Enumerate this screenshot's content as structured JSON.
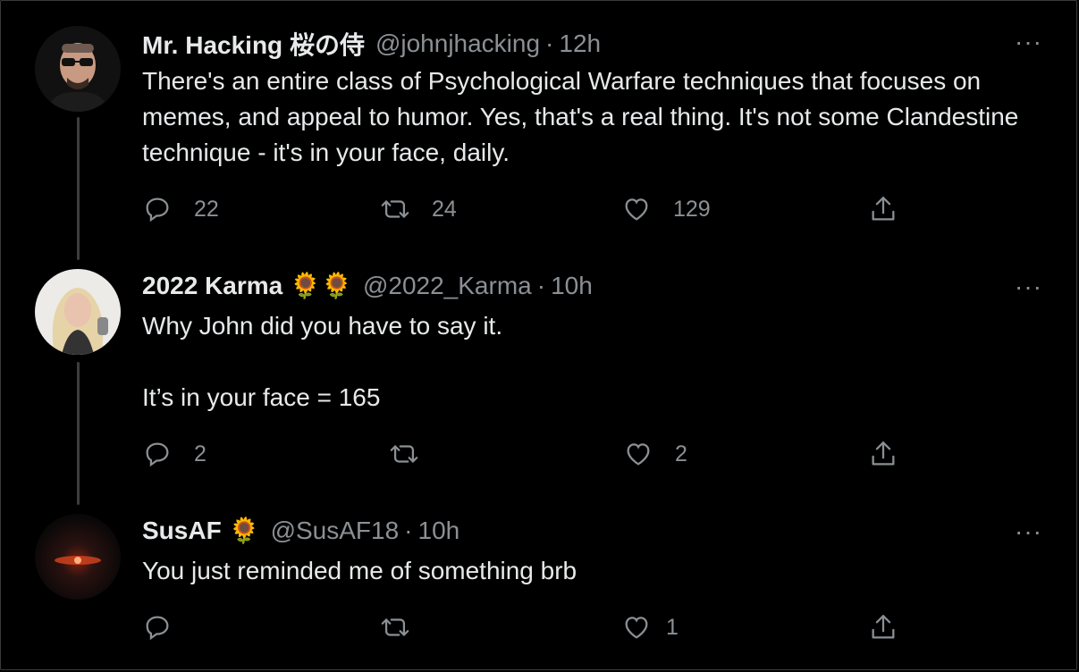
{
  "tweets": [
    {
      "name": "Mr. Hacking 桜の侍",
      "handle": "@johnjhacking",
      "dot": "·",
      "time": "12h",
      "text": [
        "There's an entire class of Psychological Warfare techniques that focuses on memes, and appeal to humor. Yes, that's a real thing. It's not some Clandestine technique - it's in your face, daily."
      ],
      "emoji": "",
      "replies": "22",
      "retweets": "24",
      "likes": "129",
      "more": "···",
      "avatar_desc": "person-with-sunglasses"
    },
    {
      "name": "2022 Karma",
      "handle": "@2022_Karma",
      "dot": "·",
      "time": "10h",
      "text": [
        "Why John did you have to say it.",
        "",
        "It’s in your face = 165"
      ],
      "emoji": "🌻🌻",
      "replies": "2",
      "retweets": "",
      "likes": "2",
      "more": "···",
      "avatar_desc": "blonde-woman"
    },
    {
      "name": "SusAF",
      "handle": "@SusAF18",
      "dot": "·",
      "time": "10h",
      "text": [
        "You just reminded me of something brb"
      ],
      "emoji": "🌻",
      "replies": "",
      "retweets": "",
      "likes": "1",
      "more": "···",
      "avatar_desc": "dark-red-glow"
    }
  ],
  "icons": {
    "reply": "reply-icon",
    "retweet": "retweet-icon",
    "like": "like-icon",
    "share": "share-icon",
    "more": "more-icon"
  },
  "colors": {
    "background": "#000000",
    "text": "#e7e9ea",
    "muted": "#8b9094",
    "thread_line": "#3d3d3d"
  }
}
